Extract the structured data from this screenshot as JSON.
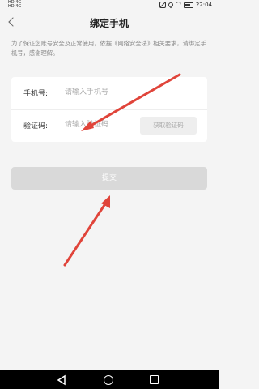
{
  "status_bar": {
    "signal_text": "HD 4G HD 4G",
    "time": "22:04",
    "icons": [
      "mute-icon",
      "location-icon",
      "wifi-icon",
      "battery-icon"
    ]
  },
  "header": {
    "title": "绑定手机",
    "back_icon": "back-icon"
  },
  "notice": "为了保证您账号安全及正常使用，依据《网络安全法》相关要求，请绑定手机号，感谢理解。",
  "form": {
    "phone_label": "手机号:",
    "phone_placeholder": "请输入手机号",
    "phone_value": "",
    "code_label": "验证码:",
    "code_placeholder": "请输入验证码",
    "code_value": "",
    "get_code_label": "获取验证码"
  },
  "submit_label": "提交",
  "colors": {
    "page_bg": "#f4f4f4",
    "annotation_arrow": "#e0443a",
    "submit_bg": "#d9d9d9"
  },
  "nav_bar": {
    "icons": [
      "nav-back-icon",
      "nav-home-icon",
      "nav-recent-icon"
    ]
  }
}
